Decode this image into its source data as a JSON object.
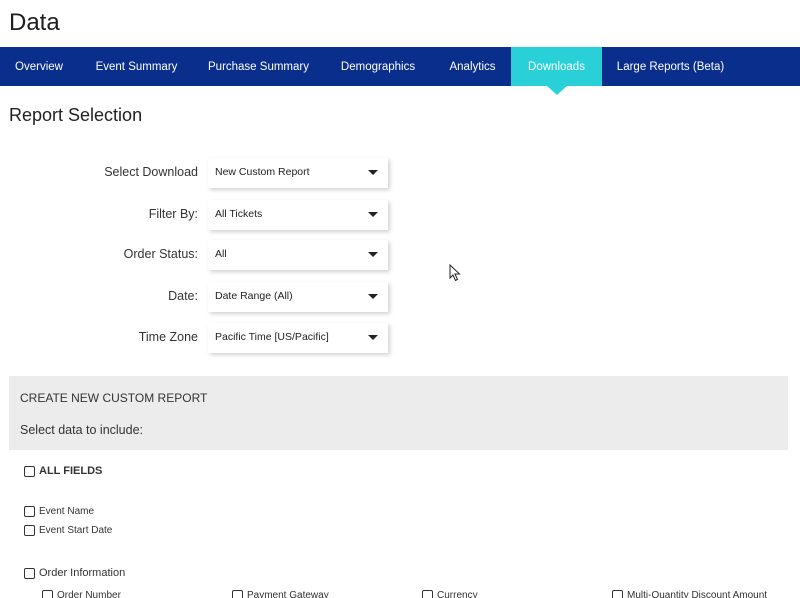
{
  "page": {
    "title": "Data"
  },
  "tabs": [
    {
      "label": "Overview",
      "active": false
    },
    {
      "label": "Event Summary",
      "active": false
    },
    {
      "label": "Purchase Summary",
      "active": false
    },
    {
      "label": "Demographics",
      "active": false
    },
    {
      "label": "Analytics",
      "active": false
    },
    {
      "label": "Downloads",
      "active": true
    },
    {
      "label": "Large Reports (Beta)",
      "active": false
    }
  ],
  "section": {
    "title": "Report Selection"
  },
  "form": {
    "select_download": {
      "label": "Select Download",
      "value": "New Custom Report"
    },
    "filter_by": {
      "label": "Filter By:",
      "value": "All Tickets"
    },
    "order_status": {
      "label": "Order Status:",
      "value": "All"
    },
    "date": {
      "label": "Date:",
      "value": "Date Range (All)"
    },
    "time_zone": {
      "label": "Time Zone",
      "value": "Pacific Time [US/Pacific]"
    }
  },
  "custom_report": {
    "title": "CREATE NEW CUSTOM REPORT",
    "subtitle": "Select data to include:",
    "all_fields": "ALL FIELDS",
    "event_fields": [
      "Event Name",
      "Event Start Date"
    ],
    "order_information": "Order Information",
    "order_fields": [
      "Order Number",
      "Payment Gateway",
      "Currency",
      "Multi-Quantity Discount Amount"
    ]
  },
  "colors": {
    "tab_bar": "#0a2e8c",
    "active_tab": "#2ad0d8",
    "panel_bg": "#ececec"
  }
}
